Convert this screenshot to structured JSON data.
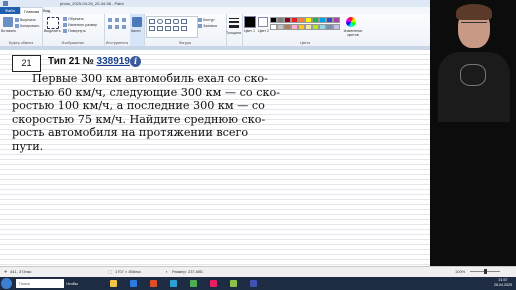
{
  "window": {
    "title": "photo_2025-04-26_20-34-58 - Paint"
  },
  "tabs": [
    {
      "label": "Файл"
    },
    {
      "label": "Главная"
    },
    {
      "label": "Вид"
    }
  ],
  "ribbon": {
    "clipboard": {
      "label": "Буфер обмена",
      "paste": "Вставить",
      "cut": "Вырезать",
      "copy": "Копировать"
    },
    "image": {
      "label": "Изображение",
      "select": "Выделить",
      "crop": "Обрезать",
      "resize": "Изменить размер",
      "rotate": "Повернуть"
    },
    "tools": {
      "label": "Инструменты"
    },
    "brushes": {
      "label": "Кисти"
    },
    "shapes": {
      "label": "Фигуры",
      "outline": "Контур",
      "fill": "Заливка"
    },
    "size": {
      "label": "Толщина"
    },
    "colors": {
      "label": "Цвета",
      "color1": "Цвет 1",
      "color2": "Цвет 2",
      "edit": "Изменение цветов",
      "palette": [
        "#000000",
        "#7f7f7f",
        "#880015",
        "#ed1c24",
        "#ff7f27",
        "#fff200",
        "#22b14c",
        "#00a2e8",
        "#3f48cc",
        "#a349a4",
        "#ffffff",
        "#c3c3c3",
        "#b97a57",
        "#ffaec9",
        "#ffc90e",
        "#efe4b0",
        "#b5e61d",
        "#99d9ea",
        "#7092be",
        "#c8bfe7"
      ]
    }
  },
  "problem": {
    "number": "21",
    "type_prefix": "Тип 21 № ",
    "type_link": "338919",
    "info_icon": "i",
    "lines": [
      "Первые 300 км автомобиль ехал со ско-",
      "ростью 60 км/ч, следующие 300 км — со ско-",
      "ростью 100 км/ч, а последние 300 км — со",
      "скоростью 75 км/ч. Найдите среднюю ско-",
      "рость автомобиля на протяжении всего",
      "пути."
    ]
  },
  "statusbar": {
    "position": "441, 374пкс",
    "dimensions": "1707 × 806пкс",
    "filesize": "Размер: 237,6КБ",
    "zoom": "100%"
  },
  "taskbar": {
    "search_placeholder": "Поиск",
    "label": "Чтобы",
    "time": "21:57",
    "date": "26.04.2025"
  }
}
